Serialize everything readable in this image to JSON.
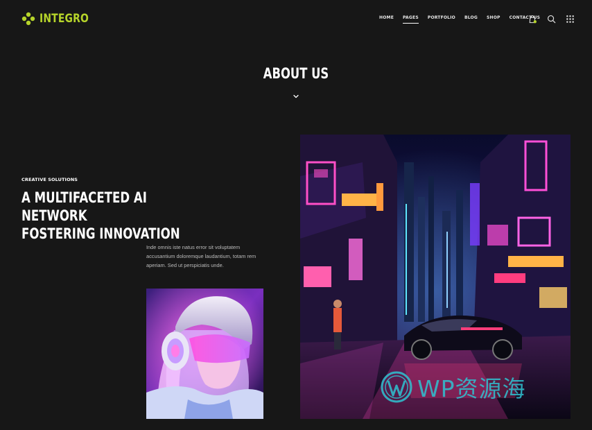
{
  "brand": {
    "name": "INTEGRO",
    "accent_color": "#b6d42a",
    "logo_icon": "four-dots-logo-icon"
  },
  "nav": {
    "items": [
      {
        "label": "HOME",
        "active": false
      },
      {
        "label": "PAGES",
        "active": true
      },
      {
        "label": "PORTFOLIO",
        "active": false
      },
      {
        "label": "BLOG",
        "active": false
      },
      {
        "label": "SHOP",
        "active": false
      },
      {
        "label": "CONTACT US",
        "active": false
      }
    ]
  },
  "header_icons": [
    "shopping-bag-icon",
    "search-icon",
    "grid-menu-icon"
  ],
  "hero": {
    "title": "ABOUT US",
    "chevron_icon": "chevron-down-icon"
  },
  "about": {
    "eyebrow": "CREATIVE SOLUTIONS",
    "headline_line1": "A MULTIFACETED AI NETWORK",
    "headline_line2": "FOSTERING INNOVATION",
    "body_line1": "Inde omnis iste natus error sit voluptatem",
    "body_line2": "accusantium doloremque laudantium, totam rem",
    "body_line3": "aperiam. Sed ut perspiciatis unde."
  },
  "images": {
    "portrait": "neon-headphones-portrait-image",
    "city": "cyberpunk-neon-city-street-image"
  },
  "watermark": {
    "text": "WP资源海",
    "color": "#2fc3d2"
  }
}
